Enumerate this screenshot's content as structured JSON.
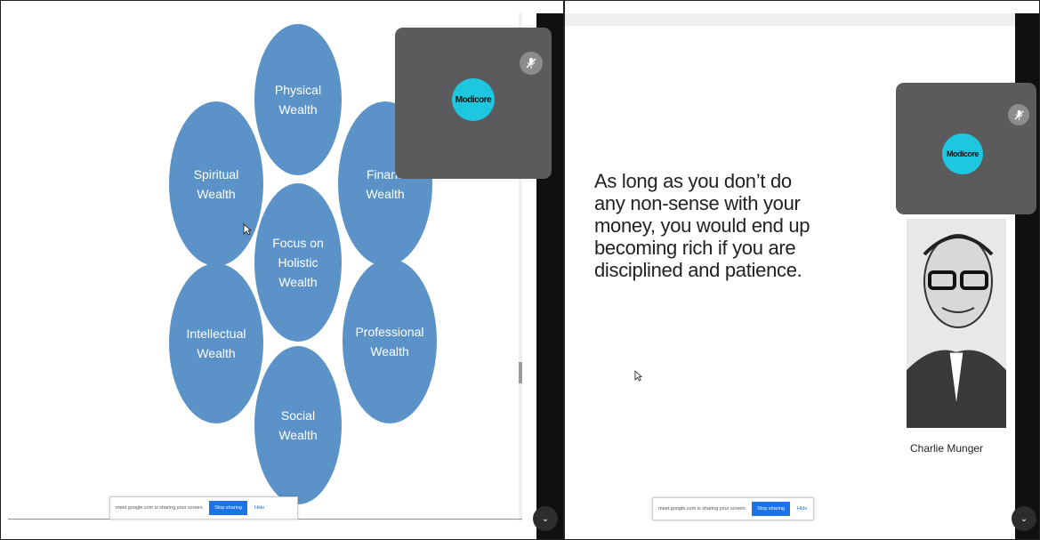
{
  "left_slide": {
    "circles": {
      "physical": "Physical\nWealth",
      "spiritual": "Spiritual\nWealth",
      "financial": "Financ\nWealth",
      "center": "Focus on\nHolistic\nWealth",
      "intellectual": "Intellectual\nWealth",
      "professional": "Professional\nWealth",
      "social": "Social\nWealth"
    },
    "circle_color": "#5b93c9"
  },
  "left_tile": {
    "avatar_text": "Modicore",
    "mute_icon": "mic-off-icon"
  },
  "left_share_bar": {
    "message": "meet.google.com is sharing your screen.",
    "stop_label": "Stop sharing",
    "hide_label": "Hide"
  },
  "right_window": {
    "title": "",
    "quote": "As long as you don’t do any non-sense with your money, you would end up becoming rich if you are disciplined and patience.",
    "author": "Charlie Munger"
  },
  "right_tile": {
    "avatar_text": "Modicore",
    "mute_icon": "mic-off-icon"
  },
  "right_share_bar": {
    "message": "meet.google.com is sharing your screen.",
    "stop_label": "Stop sharing",
    "hide_label": "Hide"
  },
  "colors": {
    "accent": "#1a73e8",
    "avatar": "#1fc6e0",
    "tile": "#5b5b5e"
  }
}
